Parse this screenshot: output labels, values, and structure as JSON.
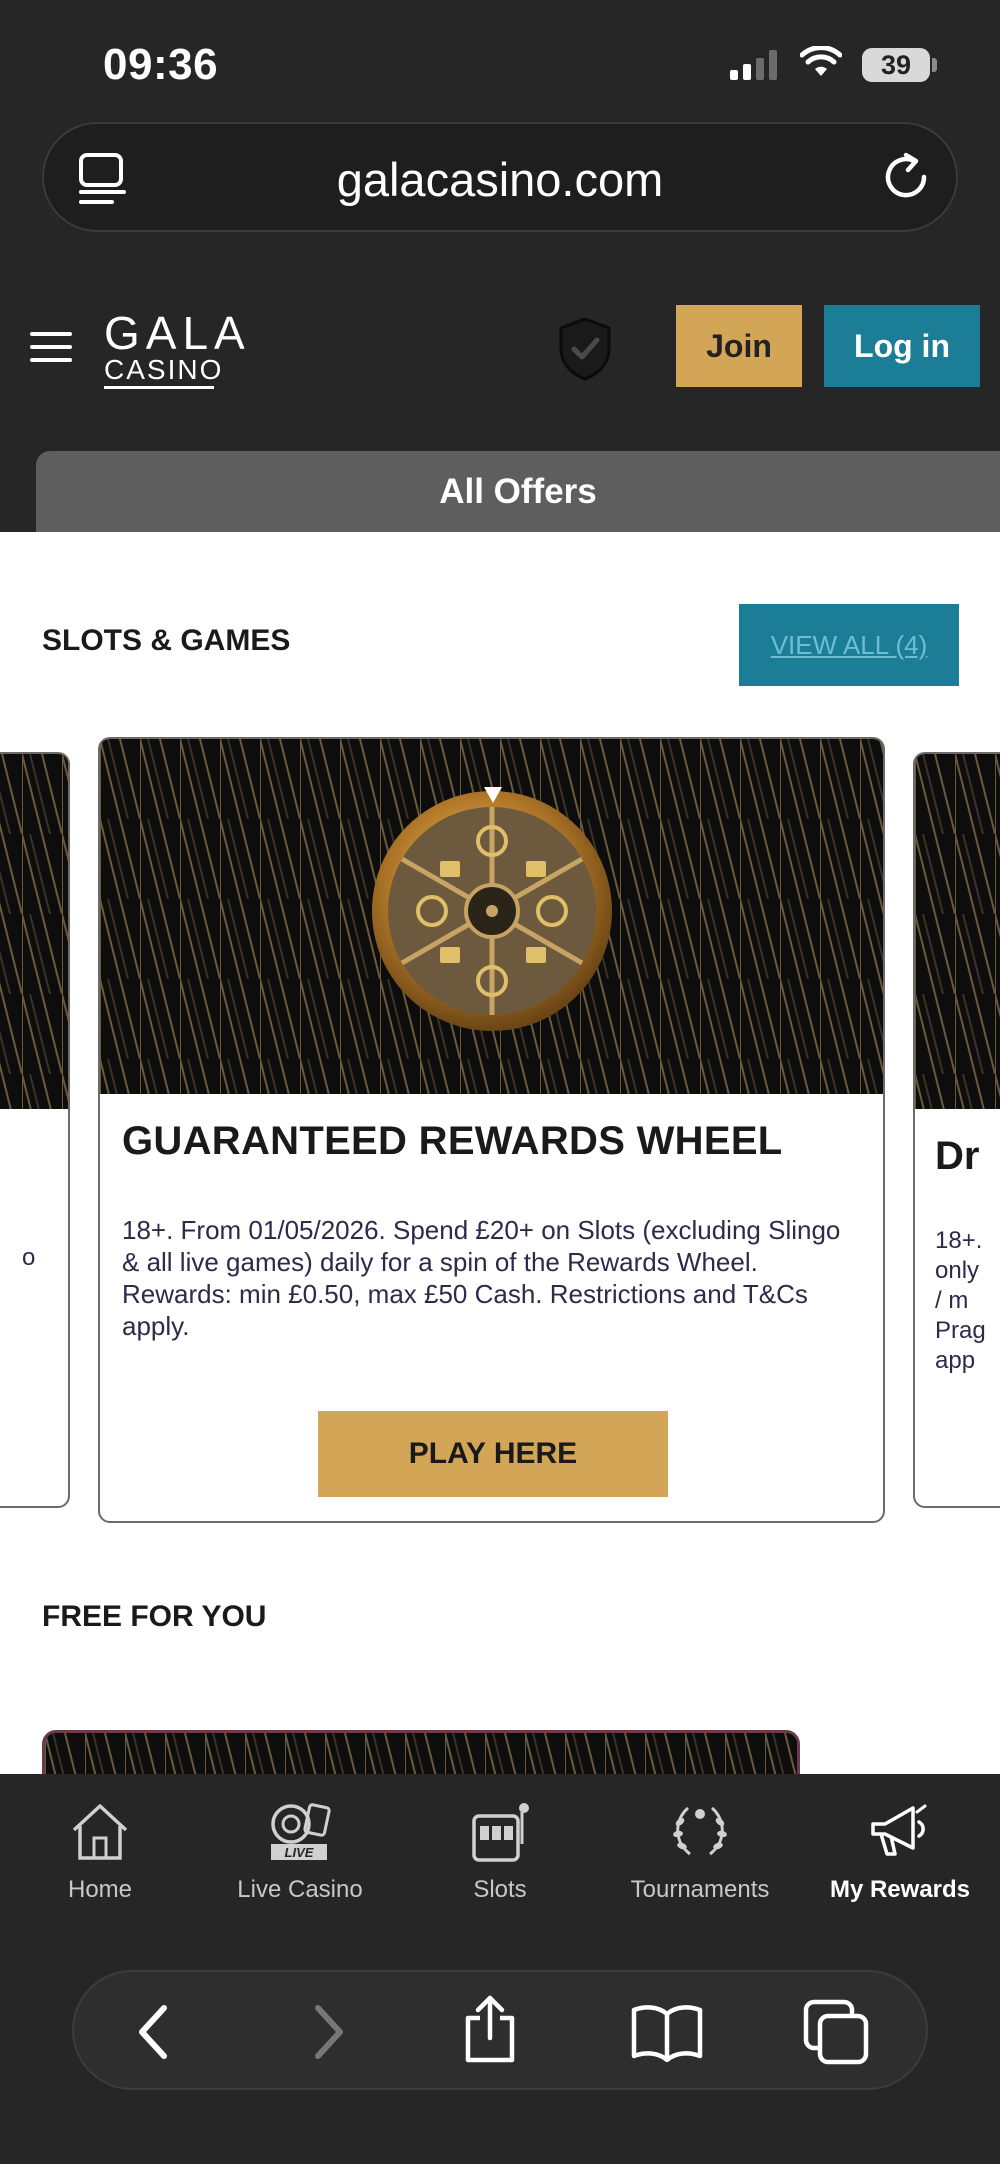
{
  "status_bar": {
    "time": "09:36",
    "battery": "39"
  },
  "browser": {
    "url": "galacasino.com"
  },
  "header": {
    "logo_top": "GALA",
    "logo_bottom": "CASINO",
    "join_label": "Join",
    "login_label": "Log in",
    "tab_label": "All Offers"
  },
  "sections": {
    "slots_title": "SLOTS & GAMES",
    "view_all_label": "VIEW ALL (4)",
    "free_title": "FREE FOR YOU"
  },
  "cards": {
    "main": {
      "title": "GUARANTEED REWARDS WHEEL",
      "description": "18+. From 01/05/2026. Spend £20+ on Slots (excluding Slingo & all live games) daily for a spin of the Rewards Wheel. Rewards: min £0.50, max £50 Cash. Restrictions and T&Cs apply.",
      "button_label": "PLAY HERE"
    },
    "left_peek": {
      "text": "o"
    },
    "right_peek": {
      "title": "Dr",
      "description_lines": [
        "18+.",
        "only",
        "/ m",
        "Prag",
        "app"
      ]
    }
  },
  "bottom_nav": {
    "items": [
      {
        "label": "Home",
        "icon": "home-icon"
      },
      {
        "label": "Live Casino",
        "icon": "live-casino-icon"
      },
      {
        "label": "Slots",
        "icon": "slots-icon"
      },
      {
        "label": "Tournaments",
        "icon": "laurel-icon"
      },
      {
        "label": "My Rewards",
        "icon": "megaphone-icon",
        "active": true
      }
    ]
  },
  "colors": {
    "gold": "#d3a556",
    "teal": "#1b7d96",
    "dark": "#262626"
  }
}
